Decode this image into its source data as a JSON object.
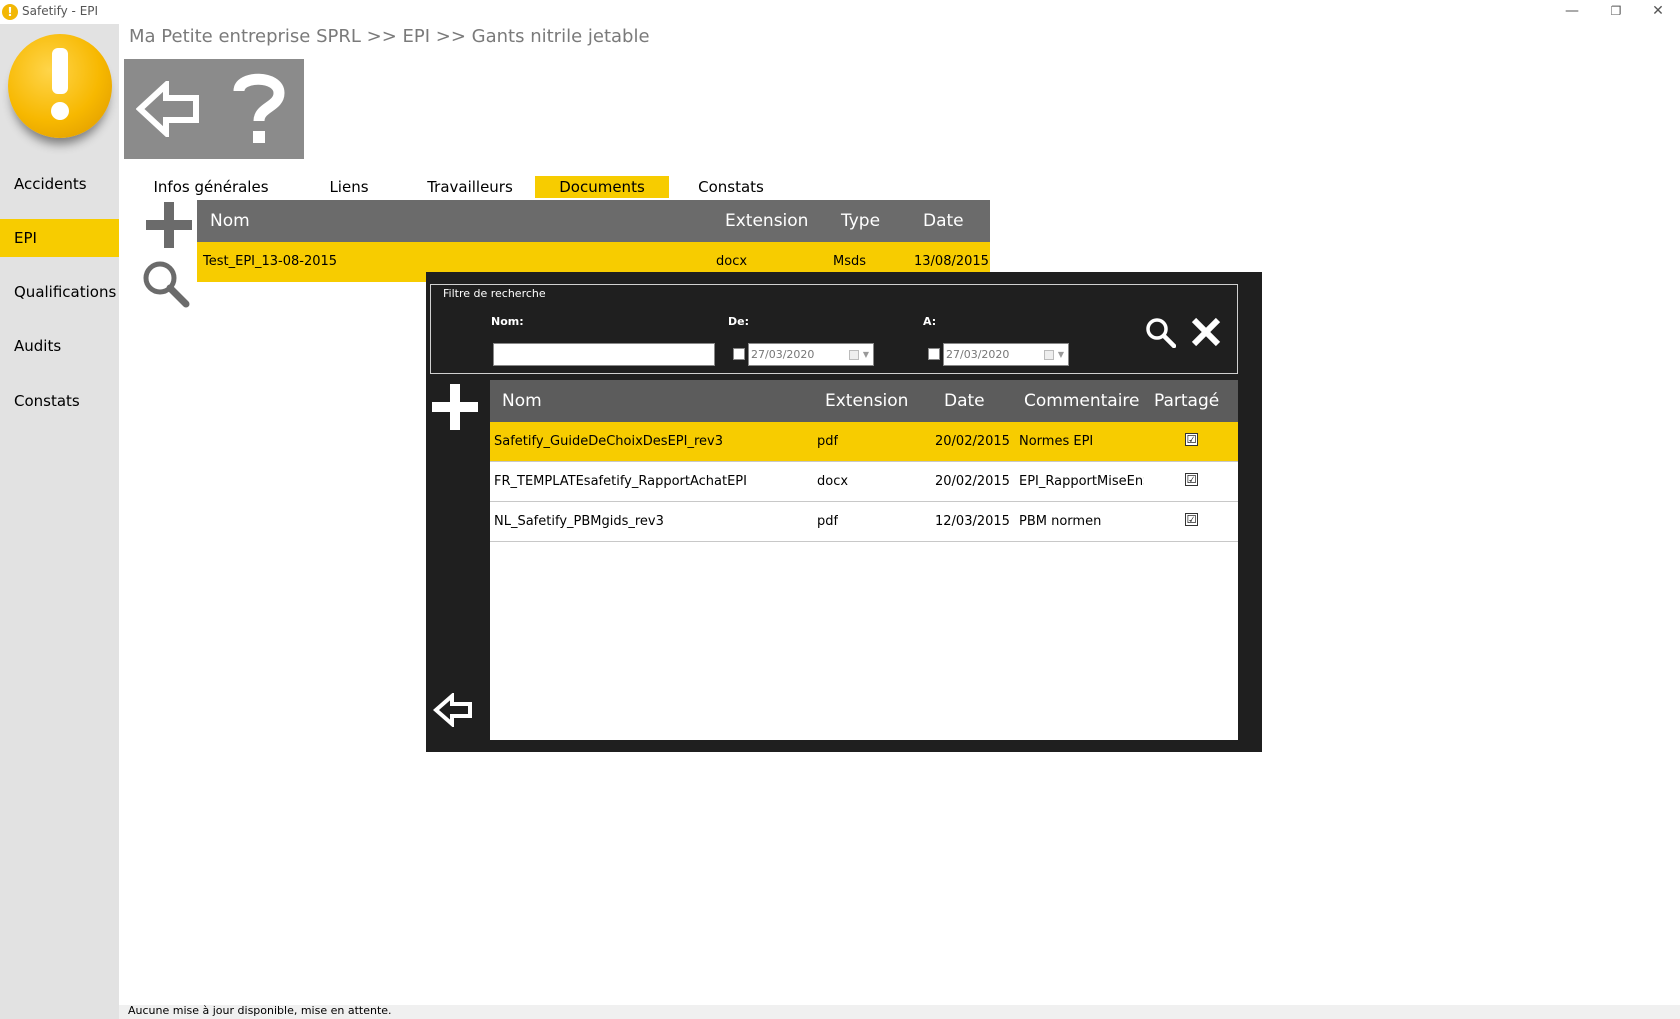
{
  "window": {
    "title": "Safetify - EPI",
    "app_icon": "warning-icon",
    "controls": {
      "minimize": "—",
      "restore": "❐",
      "close": "✕"
    }
  },
  "sidebar": {
    "logo": "exclamation-logo",
    "items": [
      {
        "label": "Accidents",
        "active": false
      },
      {
        "label": "EPI",
        "active": true
      },
      {
        "label": "Qualifications",
        "active": false
      },
      {
        "label": "Audits",
        "active": false
      },
      {
        "label": "Constats",
        "active": false
      }
    ]
  },
  "breadcrumb": "Ma Petite entreprise SPRL >> EPI >> Gants nitrile jetable",
  "toolbar": {
    "back_icon": "back-arrow-icon",
    "help_icon": "help-icon"
  },
  "tabs": [
    {
      "label": "Infos générales",
      "active": false
    },
    {
      "label": "Liens",
      "active": false
    },
    {
      "label": "Travailleurs",
      "active": false
    },
    {
      "label": "Documents",
      "active": true
    },
    {
      "label": "Constats",
      "active": false
    }
  ],
  "documents_grid": {
    "columns": [
      "Nom",
      "Extension",
      "Type",
      "Date"
    ],
    "rows": [
      {
        "nom": "Test_EPI_13-08-2015",
        "extension": "docx",
        "type": "Msds",
        "date": "13/08/2015"
      }
    ]
  },
  "dialog": {
    "filter": {
      "legend": "Filtre de recherche",
      "nom_label": "Nom:",
      "nom_value": "",
      "de_label": "De:",
      "de_date": "27/03/2020",
      "a_label": "A:",
      "a_date": "27/03/2020"
    },
    "grid": {
      "columns": [
        "Nom",
        "Extension",
        "Date",
        "Commentaire",
        "Partagé"
      ],
      "rows": [
        {
          "nom": "Safetify_GuideDeChoixDesEPI_rev3",
          "extension": "pdf",
          "date": "20/02/2015",
          "commentaire": "Normes EPI",
          "partage": "☑"
        },
        {
          "nom": "FR_TEMPLATEsafetify_RapportAchatEPI",
          "extension": "docx",
          "date": "20/02/2015",
          "commentaire": "EPI_RapportMiseEnS",
          "partage": "☑"
        },
        {
          "nom": "NL_Safetify_PBMgids_rev3",
          "extension": "pdf",
          "date": "12/03/2015",
          "commentaire": "PBM normen",
          "partage": "☑"
        }
      ]
    }
  },
  "status": "Aucune mise à jour disponible, mise en attente.",
  "colors": {
    "accent": "#f7cc00",
    "sidebar": "#e2e2e2",
    "dialog": "#1f1f1f",
    "header": "#6b6b6b"
  }
}
